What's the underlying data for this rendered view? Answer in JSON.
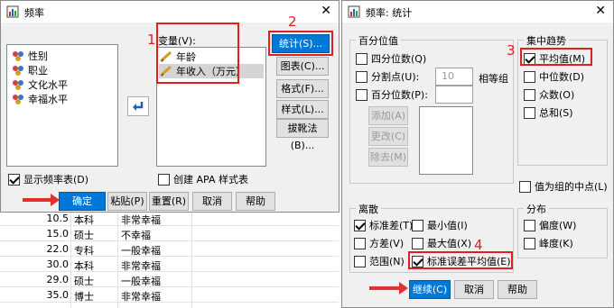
{
  "spreadsheet": {
    "rows": [
      {
        "c1": "10.5",
        "c2": "本科",
        "c3": "非常幸福"
      },
      {
        "c1": "15.0",
        "c2": "硕士",
        "c3": "不幸福"
      },
      {
        "c1": "22.0",
        "c2": "专科",
        "c3": "一般幸福"
      },
      {
        "c1": "30.0",
        "c2": "本科",
        "c3": "非常幸福"
      },
      {
        "c1": "29.0",
        "c2": "硕士",
        "c3": "一般幸福"
      },
      {
        "c1": "35.0",
        "c2": "博士",
        "c3": "非常幸福"
      }
    ]
  },
  "freq_dialog": {
    "title": "频率",
    "close": "✕",
    "source_vars": [
      "性别",
      "职业",
      "文化水平",
      "幸福水平"
    ],
    "var_label": "变量(V):",
    "selected_vars": [
      "年龄",
      "年收入（万元）"
    ],
    "side_buttons": [
      "统计(S)...",
      "图表(C)...",
      "格式(F)...",
      "样式(L)...",
      "拔靴法(B)..."
    ],
    "show_freq_tables": "显示频率表(D)",
    "apa_label": "创建 APA 样式表",
    "buttons": {
      "ok": "确定",
      "paste": "粘贴(P)",
      "reset": "重置(R)",
      "cancel": "取消",
      "help": "帮助"
    }
  },
  "stats_dialog": {
    "title": "频率: 统计",
    "close": "✕",
    "percentile": {
      "title": "百分位值",
      "quartiles": "四分位数(Q)",
      "cut_points": "分割点(U):",
      "cut_value": "10",
      "cut_suffix": "相等组",
      "percentiles": "百分位数(P):",
      "add": "添加(A)",
      "change": "更改(C)",
      "remove": "除去(M)"
    },
    "central": {
      "title": "集中趋势",
      "mean": "平均值(M)",
      "median": "中位数(D)",
      "mode": "众数(O)",
      "sum": "总和(S)"
    },
    "group_mid": "值为组的中点(L)",
    "dispersion": {
      "title": "离散",
      "std": "标准差(T)",
      "min": "最小值(I)",
      "variance": "方差(V)",
      "max": "最大值(X)",
      "range": "范围(N)",
      "se_mean": "标准误差平均值(E)"
    },
    "distribution": {
      "title": "分布",
      "skew": "偏度(W)",
      "kurt": "峰度(K)"
    },
    "buttons": {
      "continue": "继续(C)",
      "cancel": "取消",
      "help": "帮助"
    }
  },
  "annotations": {
    "n1": "1",
    "n2": "2",
    "n3": "3",
    "n4": "4"
  },
  "colors": {
    "accent": "#0078d7",
    "annotation": "#e02020"
  }
}
